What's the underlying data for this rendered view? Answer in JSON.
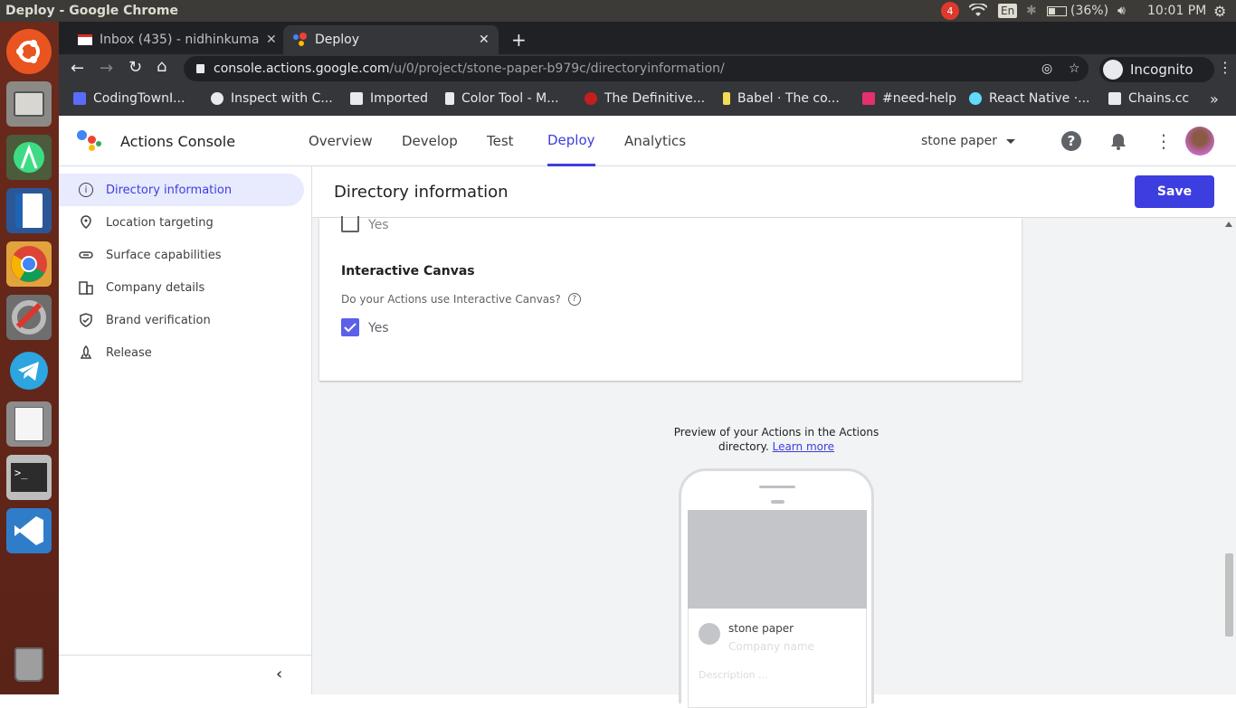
{
  "os": {
    "window_title": "Deploy - Google Chrome",
    "notification_count": "4",
    "keyboard": "En",
    "battery": "(36%)",
    "time": "10:01 PM"
  },
  "launcher": {
    "items": [
      "ubuntu-dash-icon",
      "files-icon",
      "android-studio-icon",
      "writer-icon",
      "chrome-icon",
      "settings-icon",
      "telegram-icon",
      "text-editor-icon",
      "terminal-icon",
      "vscode-icon",
      "trash-icon"
    ]
  },
  "browser": {
    "tabs": [
      {
        "label": "Inbox (435) - nidhinkumar",
        "icon": "gmail-icon"
      },
      {
        "label": "Deploy",
        "icon": "actions-icon"
      }
    ],
    "url_host": "console.actions.google.com",
    "url_path": "/u/0/project/stone-paper-b979c/directoryinformation/",
    "profile": "Incognito",
    "bookmarks": [
      {
        "label": "CodingTownI...",
        "color": "#5b6bff"
      },
      {
        "label": "Inspect with C...",
        "color": "#e8eaed"
      },
      {
        "label": "Imported",
        "color": "#e8eaed"
      },
      {
        "label": "Color Tool - M...",
        "color": "#e8eaed"
      },
      {
        "label": "The Definitive...",
        "color": "#c21f1f"
      },
      {
        "label": "Babel · The co...",
        "color": "#f5da55"
      },
      {
        "label": "#need-help",
        "color": "#e5306d"
      },
      {
        "label": "React Native ·...",
        "color": "#61dafb"
      },
      {
        "label": "Chains.cc",
        "color": "#e8eaed"
      }
    ],
    "more": "»"
  },
  "app": {
    "brand": "Actions Console",
    "nav": [
      "Overview",
      "Develop",
      "Test",
      "Deploy",
      "Analytics"
    ],
    "active_nav": "Deploy",
    "project": "stone paper",
    "accent": "#3c3ee0"
  },
  "sidebar": {
    "items": [
      {
        "label": "Directory information",
        "icon": "info-icon",
        "active": true
      },
      {
        "label": "Location targeting",
        "icon": "location-pin-icon"
      },
      {
        "label": "Surface capabilities",
        "icon": "link-icon"
      },
      {
        "label": "Company details",
        "icon": "building-icon"
      },
      {
        "label": "Brand verification",
        "icon": "shield-check-icon"
      },
      {
        "label": "Release",
        "icon": "rocket-icon"
      }
    ]
  },
  "page": {
    "title": "Directory information",
    "save": "Save"
  },
  "card": {
    "top_checkbox_label": "Yes",
    "top_checked": false,
    "section_title": "Interactive Canvas",
    "question": "Do your Actions use Interactive Canvas?",
    "checkbox_label": "Yes",
    "checked": true
  },
  "preview": {
    "text": "Preview of your Actions in the Actions",
    "text2": "directory.",
    "link": "Learn more",
    "app_name": "stone paper",
    "company_placeholder": "Company name",
    "description_placeholder": "Description ..."
  }
}
